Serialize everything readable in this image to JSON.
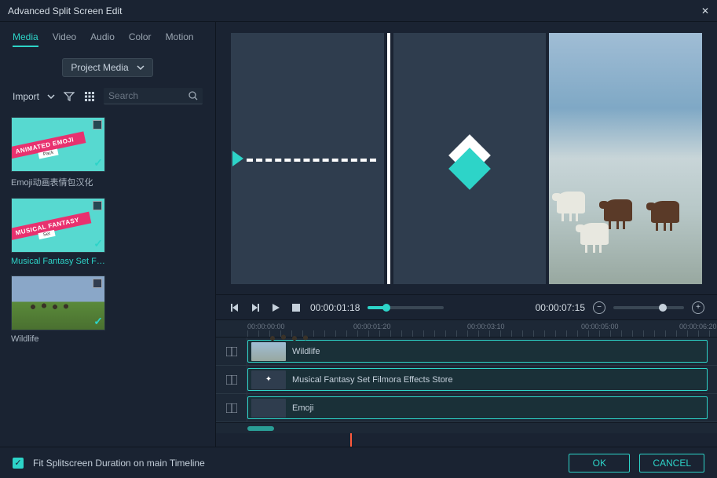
{
  "window": {
    "title": "Advanced Split Screen Edit"
  },
  "tabs": [
    "Media",
    "Video",
    "Audio",
    "Color",
    "Motion"
  ],
  "active_tab": 0,
  "project_select": {
    "label": "Project Media"
  },
  "import": {
    "label": "Import"
  },
  "search": {
    "placeholder": "Search"
  },
  "media_items": [
    {
      "label": "Emoji动画表情包汉化",
      "banner": "ANIMATED EMOJI",
      "sub": "Pack",
      "checked": true,
      "highlight": false
    },
    {
      "label": "Musical Fantasy Set  Film...",
      "banner": "MUSICAL FANTASY",
      "sub": "Set",
      "checked": true,
      "highlight": true
    },
    {
      "label": "Wildlife",
      "checked": true,
      "highlight": false
    }
  ],
  "player": {
    "current_time": "00:00:01:18",
    "total_time": "00:00:07:15",
    "progress_pct": 24
  },
  "timeline": {
    "ruler_labels": [
      "00:00:00:00",
      "00:00:01:20",
      "00:00:03:10",
      "00:00:05:00",
      "00:00:06:20"
    ],
    "tracks": [
      {
        "label": "Wildlife",
        "clip_width_pct": 98
      },
      {
        "label": "Musical Fantasy Set  Filmora Effects Store",
        "clip_width_pct": 98
      },
      {
        "label": "Emoji",
        "clip_width_pct": 98
      }
    ]
  },
  "footer": {
    "checkbox_checked": true,
    "checkbox_label": "Fit Splitscreen Duration on main Timeline",
    "ok": "OK",
    "cancel": "CANCEL"
  }
}
